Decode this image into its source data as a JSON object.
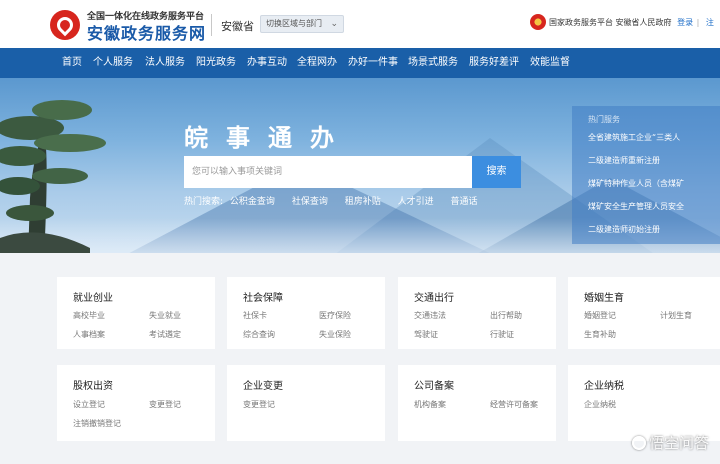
{
  "header": {
    "subtitle": "全国一体化在线政务服务平台",
    "site_name": "安徽政务服务网",
    "province": "安徽省",
    "region_switch": "切换区域与部门",
    "gov_links": "国家政务服务平台 安徽省人民政府",
    "login": "登录",
    "bar": "|",
    "register": "注"
  },
  "nav": [
    "首页",
    "个人服务",
    "法人服务",
    "阳光政务",
    "办事互动",
    "全程网办",
    "办好一件事",
    "场景式服务",
    "服务好差评",
    "效能监督"
  ],
  "hero": {
    "title": "皖事通办",
    "search_placeholder": "您可以输入事项关键词",
    "search_button": "搜索",
    "hot_label": "热门搜索:",
    "hot_terms": [
      "公积金查询",
      "社保查询",
      "租房补贴",
      "人才引进",
      "普通话"
    ]
  },
  "hot_service": {
    "title": "热门服务",
    "items": [
      "全省建筑施工企业“三类人",
      "二级建造师重新注册",
      "煤矿特种作业人员（含煤矿",
      "煤矿安全生产管理人员安全",
      "二级建造师初始注册"
    ]
  },
  "cards": [
    {
      "title": "就业创业",
      "links": [
        "高校毕业",
        "失业就业",
        "人事档案",
        "考试遴定"
      ]
    },
    {
      "title": "社会保障",
      "links": [
        "社保卡",
        "医疗保险",
        "综合查询",
        "失业保险"
      ]
    },
    {
      "title": "交通出行",
      "links": [
        "交通违法",
        "出行帮助",
        "驾驶证",
        "行驶证"
      ]
    },
    {
      "title": "婚姻生育",
      "links": [
        "婚姻登记",
        "计划生育",
        "生育补助"
      ]
    },
    {
      "title": "股权出资",
      "links": [
        "设立登记",
        "变更登记",
        "注销撤销登记"
      ]
    },
    {
      "title": "企业变更",
      "links": [
        "变更登记"
      ]
    },
    {
      "title": "公司备案",
      "links": [
        "机构备案",
        "经营许可备案"
      ]
    },
    {
      "title": "企业纳税",
      "links": [
        "企业纳税"
      ]
    }
  ],
  "watermark": "悟空问答",
  "colors": {
    "nav": "#1a5fa8",
    "accent": "#3c8ee0",
    "brand_red": "#d7261e"
  }
}
